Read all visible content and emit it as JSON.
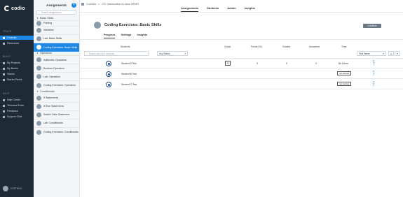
{
  "brand": {
    "name": "codio"
  },
  "nav": {
    "teach_label": "TEACH",
    "teach_items": [
      "Courses",
      "Resources"
    ],
    "build_label": "BUILD",
    "build_items": [
      "My Projects",
      "My Books",
      "Stacks",
      "Starter Packs"
    ],
    "help_label": "HELP",
    "help_items": [
      "Help Center",
      "Technical Docs",
      "Feedback",
      "Support Chat"
    ],
    "user_name": "DOETRICK"
  },
  "assignments": {
    "title": "Assignments",
    "search_placeholder": "Search assignments",
    "groups": [
      {
        "label": "Basic Skills",
        "items": [
          "Printing",
          "Variables",
          "Lab: Basic Skills",
          "Coding Exercises: Basic Skills"
        ]
      },
      {
        "label": "Operators",
        "items": [
          "Arithmetic Operators",
          "Boolean Operators",
          "Lab: Operators",
          "Coding Exercises: Operators"
        ]
      },
      {
        "label": "Conditionals",
        "items": [
          "If Statements",
          "If Else Statements",
          "Switch Case Statement",
          "Lab: Conditionals",
          "Coding Exercises: Conditionals"
        ]
      }
    ],
    "active_item": "Coding Exercises: Basic Skills"
  },
  "topbar": {
    "breadcrumb": [
      "Courses",
      "CS: Introduction in Java DEMO"
    ],
    "tabs": [
      "Assignments",
      "Students",
      "Admin",
      "Insights"
    ],
    "active_tab": "Assignments"
  },
  "main": {
    "title": "Coding Exercises: Basic Skills",
    "actions_label": "≡ Actions",
    "subtabs": [
      "Progress",
      "Settings",
      "Insights"
    ],
    "active_subtab": "Progress",
    "columns": {
      "students": "Students",
      "grade": "Grade",
      "points": "Points (%)",
      "graded": "Graded",
      "answered": "Answered",
      "time": "Time"
    },
    "filter_placeholder": "Search among 3 students",
    "status_filter": "Any Status",
    "sort_select": "First Name",
    "rows": [
      {
        "name": "Student A Test",
        "points": "0",
        "graded": "0",
        "answered": "0",
        "time": "8h 14min",
        "status": ""
      },
      {
        "name": "Student B Test",
        "points": "",
        "graded": "",
        "answered": "",
        "time": "",
        "status": "not started"
      },
      {
        "name": "Student C Test",
        "points": "",
        "graded": "",
        "answered": "",
        "time": "",
        "status": "not started"
      }
    ]
  },
  "colors": {
    "nav_bg": "#1f2a37",
    "accent": "#1e88e5"
  }
}
